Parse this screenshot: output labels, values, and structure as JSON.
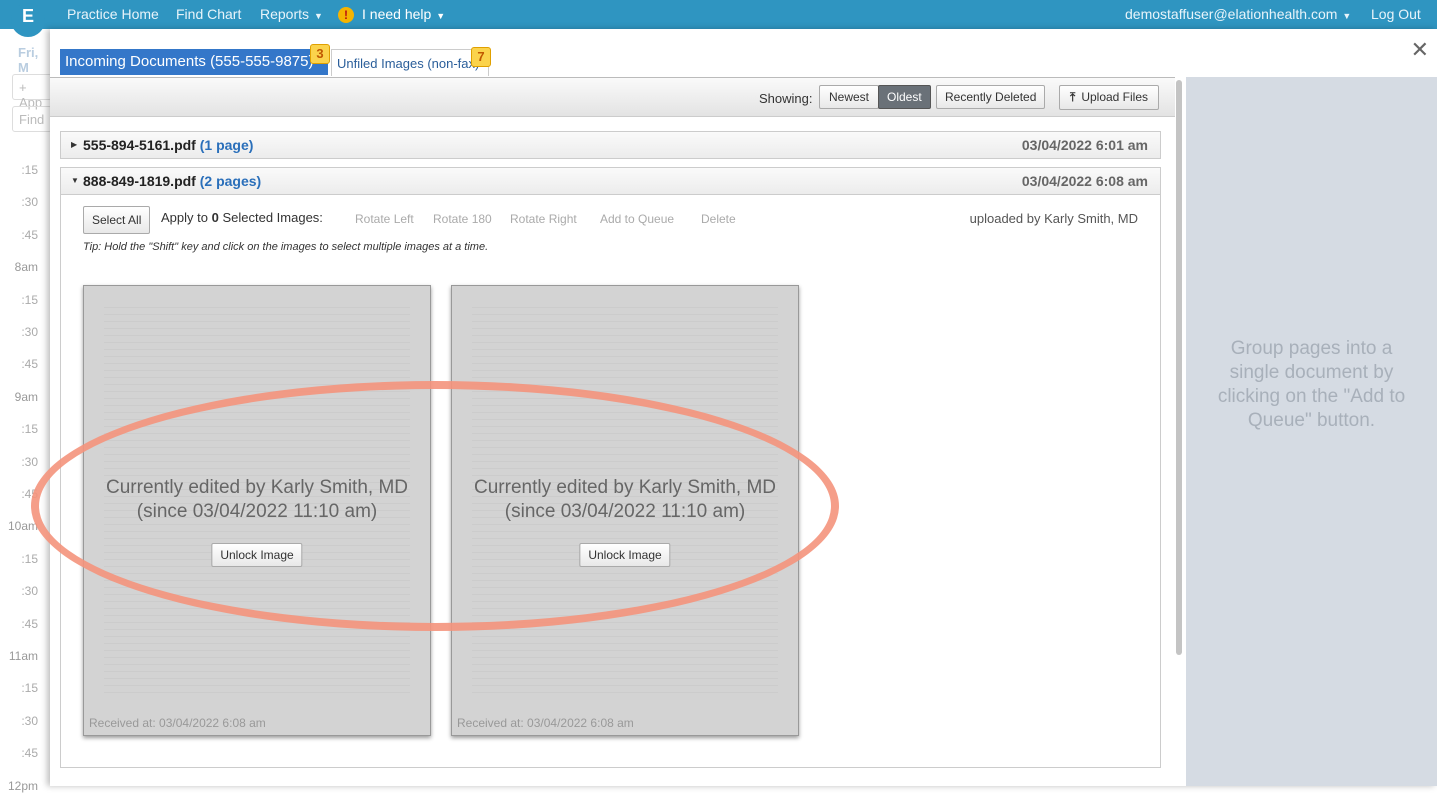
{
  "topbar": {
    "logo": "E",
    "nav": [
      "Practice Home",
      "Find Chart",
      "Reports",
      "I need help"
    ],
    "user": "demostaffuser@elationhealth.com",
    "logout": "Log Out"
  },
  "background": {
    "date": "Fri, M",
    "add": "+ App",
    "find": "Find",
    "times": [
      ":15",
      ":30",
      ":45",
      "8am",
      ":15",
      ":30",
      ":45",
      "9am",
      ":15",
      ":30",
      ":45",
      "10am",
      ":15",
      ":30",
      ":45",
      "11am",
      ":15",
      ":30",
      ":45",
      "12pm"
    ]
  },
  "tabs": [
    {
      "label": "Incoming Documents (555-555-9875)",
      "badge": "3",
      "active": true
    },
    {
      "label": "Unfiled Images (non-fax)",
      "badge": "7",
      "active": false
    }
  ],
  "toolbar": {
    "showing": "Showing:",
    "newest": "Newest",
    "oldest": "Oldest",
    "selected": "Oldest",
    "recently_deleted": "Recently Deleted",
    "upload": "Upload Files"
  },
  "documents": [
    {
      "name": "555-894-5161.pdf",
      "pages": "(1 page)",
      "date": "03/04/2022 6:01 am",
      "expanded": false
    },
    {
      "name": "888-849-1819.pdf",
      "pages": "(2 pages)",
      "date": "03/04/2022 6:08 am",
      "expanded": true
    }
  ],
  "panel": {
    "select_all": "Select All",
    "apply_to": "Apply to",
    "count": "0",
    "selected_images": "Selected Images:",
    "actions": [
      "Rotate Left",
      "Rotate 180",
      "Rotate Right",
      "Add to Queue",
      "Delete"
    ],
    "uploaded_by": "uploaded by Karly Smith, MD",
    "tip": "Tip: Hold the \"Shift\" key and click on the images to select multiple images at a time."
  },
  "pages": [
    {
      "message": "Currently edited by Karly Smith, MD (since 03/04/2022 11:10 am)",
      "unlock": "Unlock Image",
      "received": "Received at: 03/04/2022 6:08 am"
    },
    {
      "message": "Currently edited by Karly Smith, MD (since 03/04/2022 11:10 am)",
      "unlock": "Unlock Image",
      "received": "Received at: 03/04/2022 6:08 am"
    }
  ],
  "side": {
    "text": "Group pages into a single document by clicking on the \"Add to Queue\" button."
  },
  "colors": {
    "topbar": "#2f95c1",
    "active_tab": "#3477c9",
    "annotation": "#f4937c"
  }
}
